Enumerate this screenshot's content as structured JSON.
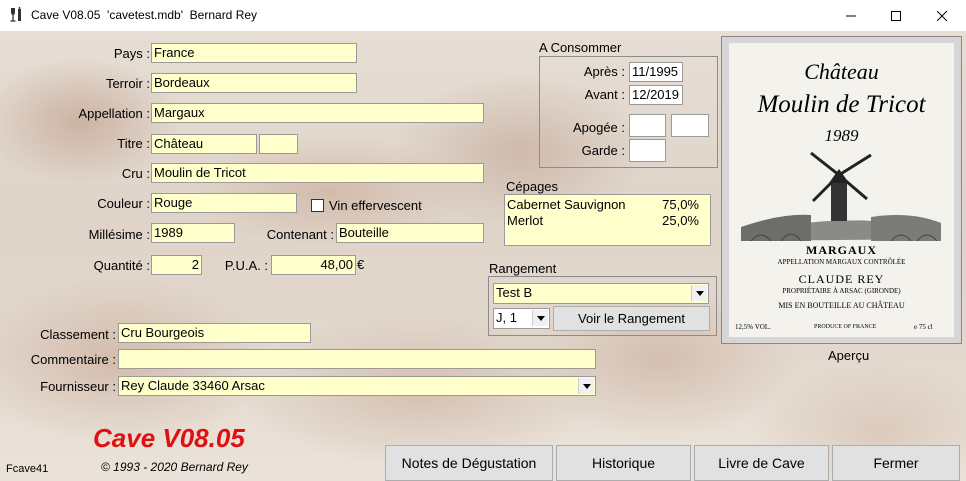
{
  "window": {
    "title": "Cave V08.05  'cavetest.mdb'  Bernard Rey",
    "icon": "wine-glass-icon",
    "controls": {
      "minimize": "minimize-icon",
      "maximize": "maximize-icon",
      "close": "close-icon"
    }
  },
  "form": {
    "pays": {
      "label": "Pays :",
      "value": "France"
    },
    "terroir": {
      "label": "Terroir :",
      "value": "Bordeaux"
    },
    "appellation": {
      "label": "Appellation :",
      "value": "Margaux"
    },
    "titre": {
      "label": "Titre :",
      "value": "Château",
      "value2": "",
      "value3": ""
    },
    "cru": {
      "label": "Cru :",
      "value": "Moulin de Tricot"
    },
    "couleur": {
      "label": "Couleur :",
      "value": "Rouge"
    },
    "effervescent": {
      "label": "Vin effervescent",
      "checked": false
    },
    "millesime": {
      "label": "Millésime :",
      "value": "1989"
    },
    "contenant": {
      "label": "Contenant :",
      "value": "Bouteille"
    },
    "quantite": {
      "label": "Quantité :",
      "value": "2"
    },
    "pua": {
      "label": "P.U.A. :",
      "value": "48,00",
      "currency": "€"
    },
    "classement": {
      "label": "Classement :",
      "value": "Cru Bourgeois"
    },
    "commentaire": {
      "label": "Commentaire :",
      "value": ""
    },
    "fournisseur": {
      "label": "Fournisseur :",
      "value": "Rey Claude 33460 Arsac"
    }
  },
  "consommer": {
    "title": "A Consommer",
    "apres": {
      "label": "Après :",
      "value": "11/1995"
    },
    "avant": {
      "label": "Avant :",
      "value": "12/2019"
    },
    "apogee": {
      "label": "Apogée :",
      "value1": "",
      "value2": ""
    },
    "garde": {
      "label": "Garde :",
      "value": ""
    }
  },
  "cepages": {
    "title": "Cépages",
    "items": [
      {
        "name": "Cabernet Sauvignon",
        "pct": "75,0%"
      },
      {
        "name": "Merlot",
        "pct": "25,0%"
      }
    ]
  },
  "rangement": {
    "title": "Rangement",
    "cave": "Test B",
    "position": "J, 1",
    "voir_label": "Voir le Rangement"
  },
  "label_image": {
    "line1": "Château",
    "line2": "Moulin de Tricot",
    "year": "1989",
    "appellation": "MARGAUX",
    "controlee": "APPELLATION MARGAUX CONTRÔLÉE",
    "producer": "CLAUDE REY",
    "proprietaire": "PROPRIÉTAIRE À ARSAC (GIRONDE)",
    "mise": "MIS EN BOUTEILLE AU CHÂTEAU",
    "vol": "12,5% VOL.",
    "produce": "PRODUCE OF FRANCE",
    "size": "e 75 cl",
    "caption": "Aperçu"
  },
  "footer": {
    "brand": "Cave V08.05",
    "copyright": "© 1993 - 2020 Bernard Rey",
    "form_id": "Fcave41",
    "buttons": {
      "notes": "Notes de Dégustation",
      "historique": "Historique",
      "livre": "Livre de Cave",
      "fermer": "Fermer"
    }
  },
  "colors": {
    "field_bg": "#ffffcc",
    "brand_red": "#e01010",
    "accent": "#0078d7"
  }
}
